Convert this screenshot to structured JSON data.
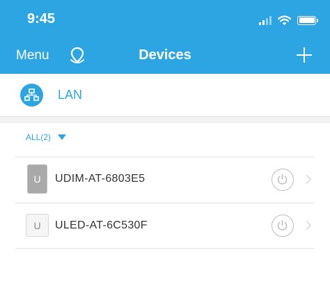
{
  "status_bar": {
    "time": "9:45",
    "icons": [
      "signal-icon",
      "wifi-icon",
      "battery-icon"
    ]
  },
  "nav": {
    "menu_label": "Menu",
    "title": "Devices",
    "logo_icon": "location-swirl-icon",
    "add_icon": "plus-icon"
  },
  "network": {
    "label": "LAN",
    "icon": "network-icon"
  },
  "filter": {
    "label": "ALL(2)",
    "icon": "caret-down-icon"
  },
  "devices": [
    {
      "badge": "U",
      "name": "UDIM-AT-6803E5",
      "power_icon": "power-icon",
      "chevron_icon": "chevron-right-icon"
    },
    {
      "badge": "U",
      "name": "ULED-AT-6C530F",
      "power_icon": "power-icon",
      "chevron_icon": "chevron-right-icon"
    }
  ],
  "colors": {
    "accent": "#2ea5e3",
    "header_bg": "#2ea5e3",
    "text": "#333333",
    "muted": "#bcbcbc"
  }
}
